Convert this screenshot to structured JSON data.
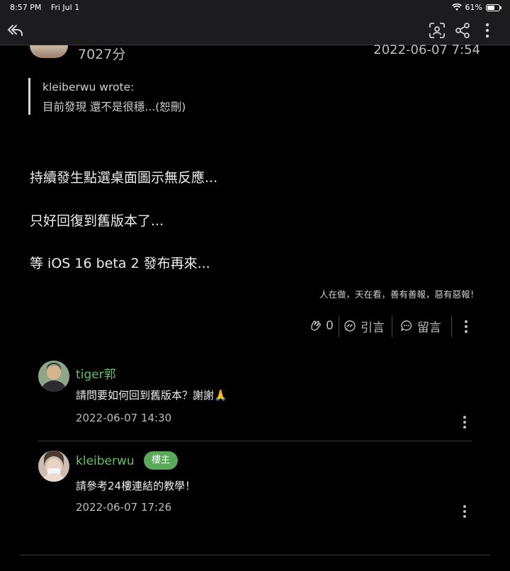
{
  "status_bar": {
    "time": "8:57 PM",
    "date": "Fri Jul 1",
    "battery": "61%",
    "battery_level": 0.61
  },
  "nav": {
    "icons": [
      "back-reply-icon",
      "scan-icon",
      "share-icon",
      "more-vertical-icon"
    ]
  },
  "post": {
    "author_score": "7027分",
    "time": "2022-06-07 7:54",
    "quote": {
      "author_line": "kleiberwu wrote:",
      "text": "目前發現 還不是很穩...(恕刪)"
    },
    "body": [
      "持續發生點選桌面圖示無反應...",
      "只好回復到舊版本了...",
      "等 iOS 16 beta 2 發布再來..."
    ],
    "signature": "人在做，天在看，善有善報，惡有惡報！",
    "actions": {
      "like_count": "0",
      "quote_label": "引言",
      "comment_label": "留言"
    }
  },
  "comments": [
    {
      "name": "tiger郭",
      "text": "請問要如何回到舊版本？謝謝🙏",
      "time": "2022-06-07 14:30"
    },
    {
      "name": "kleiberwu",
      "badge": "樓主",
      "text": "請參考24樓連結的教學！",
      "time": "2022-06-07 17:26"
    }
  ],
  "colors": {
    "background": "#000000",
    "accent_green": "#6bbf6b",
    "badge_green": "#5aa85a"
  }
}
